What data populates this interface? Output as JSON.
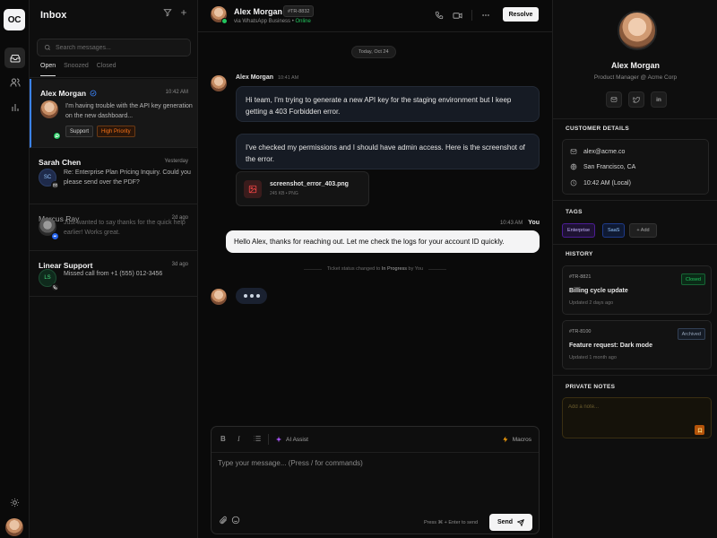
{
  "rail": {
    "logo": "OC",
    "items": [
      {
        "icon": "inbox-icon",
        "active": true
      },
      {
        "icon": "users-icon",
        "active": false
      },
      {
        "icon": "bar-chart-icon",
        "active": false
      }
    ],
    "bottom_icon": "sun-icon"
  },
  "inbox": {
    "title": "Inbox",
    "search_placeholder": "Search messages...",
    "tabs": [
      "Open",
      "Snoozed",
      "Closed"
    ],
    "active_tab": "Open",
    "conversations": [
      {
        "name": "Alex Morgan",
        "time": "10:42 AM",
        "preview": "I'm having trouble with the API key generation on the new dashboard...",
        "verified": true,
        "channel": "whatsapp",
        "tags": [
          "Support",
          "High Priority"
        ],
        "active": true
      },
      {
        "name": "Sarah Chen",
        "time": "Yesterday",
        "preview": "Re: Enterprise Plan Pricing Inquiry. Could you please send over the PDF?",
        "initials": "SC",
        "channel": "email"
      },
      {
        "name": "Marcus Ray",
        "time": "2d ago",
        "preview": "Just wanted to say thanks for the quick help earlier! Works great.",
        "channel": "messenger",
        "dim": true
      },
      {
        "name": "Linear Support",
        "time": "3d ago",
        "preview": "Missed call from +1 (555) 012-3456",
        "initials": "LS",
        "channel": "phone"
      }
    ]
  },
  "chat": {
    "contact_name": "Alex Morgan",
    "ticket": "#TR-8832",
    "via": "via WhatsApp Business",
    "status": "Online",
    "resolve_label": "Resolve",
    "date_divider": "Today, Oct 24",
    "author": "Alex Morgan",
    "author_time": "10:41 AM",
    "messages_in": [
      "Hi team, I'm trying to generate a new API key for the staging environment but I keep getting a 403 Forbidden error.",
      "I've checked my permissions and I should have admin access. Here is the screenshot of the error."
    ],
    "attachment": {
      "name": "screenshot_error_403.png",
      "meta": "245 KB • PNG"
    },
    "reply": {
      "time": "10:43 AM",
      "author": "You",
      "text": "Hello Alex, thanks for reaching out. Let me check the logs for your account ID quickly."
    },
    "system_event": {
      "prefix": "Ticket status changed to",
      "status": "In Progress",
      "suffix": "by You"
    },
    "composer": {
      "ai_label": "AI Assist",
      "macros_label": "Macros",
      "placeholder": "Type your message... (Press / for commands)",
      "hint": "Press ⌘ + Enter to send",
      "send_label": "Send"
    }
  },
  "profile": {
    "name": "Alex Morgan",
    "role": "Product Manager @ Acme Corp",
    "social_icons": [
      "mail-icon",
      "twitter-icon",
      "linkedin-icon"
    ],
    "details_title": "CUSTOMER DETAILS",
    "email": "alex@acme.co",
    "location": "San Francisco, CA",
    "local_time": "10:42 AM (Local)",
    "tags_title": "TAGS",
    "tags": [
      "Enterprise",
      "SaaS"
    ],
    "add_tag_label": "+ Add",
    "history_title": "HISTORY",
    "history": [
      {
        "id": "#TR-8821",
        "title": "Billing cycle update",
        "updated": "Updated 2 days ago",
        "status": "Closed"
      },
      {
        "id": "#TR-8100",
        "title": "Feature request: Dark mode",
        "updated": "Updated 1 month ago",
        "status": "Archived"
      }
    ],
    "notes_title": "PRIVATE NOTES",
    "notes_placeholder": "Add a note..."
  },
  "colors": {
    "accent": "#3b82f6",
    "online": "#22c55e",
    "whatsapp": "#22c55e",
    "high_priority": "#f97316",
    "closed": "#22c55e",
    "ai": "#a855f7",
    "macros": "#f59e0b"
  }
}
